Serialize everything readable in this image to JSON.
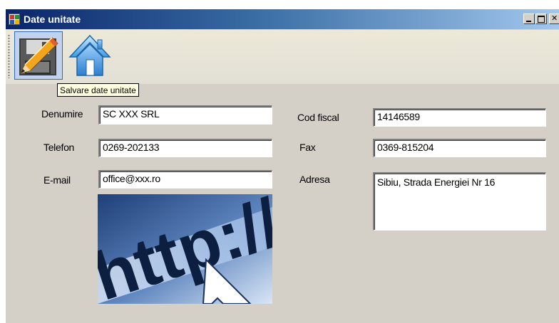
{
  "window": {
    "title": "Date unitate"
  },
  "toolbar": {
    "save_icon": "floppy-pencil-icon",
    "home_icon": "home-icon",
    "tooltip": "Salvare date unitate"
  },
  "form": {
    "denumire": {
      "label": "Denumire",
      "value": "SC XXX SRL"
    },
    "telefon": {
      "label": "Telefon",
      "value": "0269-202133"
    },
    "email": {
      "label": "E-mail",
      "value": "office@xxx.ro"
    },
    "cod_fiscal": {
      "label": "Cod fiscal",
      "value": "14146589"
    },
    "fax": {
      "label": "Fax",
      "value": "0369-815204"
    },
    "adresa": {
      "label": "Adresa",
      "value": "Sibiu, Strada Energiei Nr 16"
    }
  },
  "picture": {
    "text": "http://w",
    "colors": {
      "dark": "#1f3f78",
      "light": "#d8e6f6"
    }
  }
}
